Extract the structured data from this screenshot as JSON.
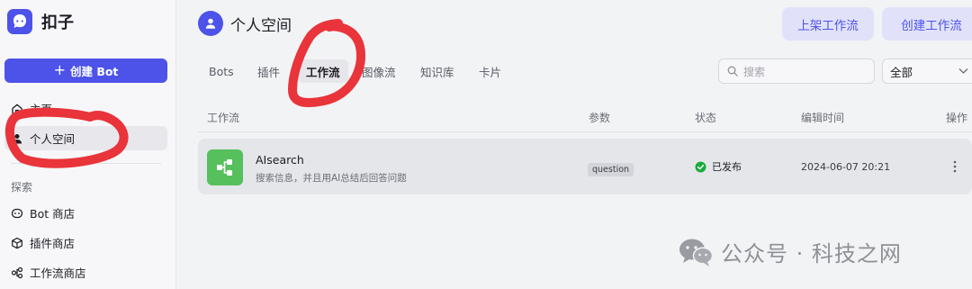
{
  "brand": {
    "name": "扣子"
  },
  "sidebar": {
    "create_bot_label": "创建 Bot",
    "items": [
      {
        "label": "主页",
        "icon": "home-icon"
      },
      {
        "label": "个人空间",
        "icon": "person-icon",
        "active": true
      }
    ],
    "explore_label": "探索",
    "explore_items": [
      {
        "label": "Bot 商店",
        "icon": "bot-icon"
      },
      {
        "label": "插件商店",
        "icon": "cube-icon"
      },
      {
        "label": "工作流商店",
        "icon": "workflow-icon"
      }
    ]
  },
  "header": {
    "title": "个人空间",
    "publish_workflow_label": "上架工作流",
    "create_workflow_label": "创建工作流"
  },
  "tabs": [
    {
      "label": "Bots"
    },
    {
      "label": "插件"
    },
    {
      "label": "工作流",
      "active": true
    },
    {
      "label": "图像流"
    },
    {
      "label": "知识库"
    },
    {
      "label": "卡片"
    }
  ],
  "search": {
    "placeholder": "搜索"
  },
  "filter": {
    "selected": "全部"
  },
  "table": {
    "columns": [
      "工作流",
      "参数",
      "状态",
      "编辑时间",
      "操作"
    ],
    "rows": [
      {
        "name": "AIsearch",
        "description": "搜索信息，并且用AI总结后回答问题",
        "param": "question",
        "status": "已发布",
        "edited": "2024-06-07 20:21"
      }
    ]
  },
  "watermark": {
    "text": "公众号 · 科技之网"
  },
  "colors": {
    "accent": "#4d53e8",
    "accent_light": "#e1e2f9",
    "status_green": "#1aab3c",
    "workflow_icon_bg": "#55c05c",
    "annotation_red": "#e8343a"
  }
}
